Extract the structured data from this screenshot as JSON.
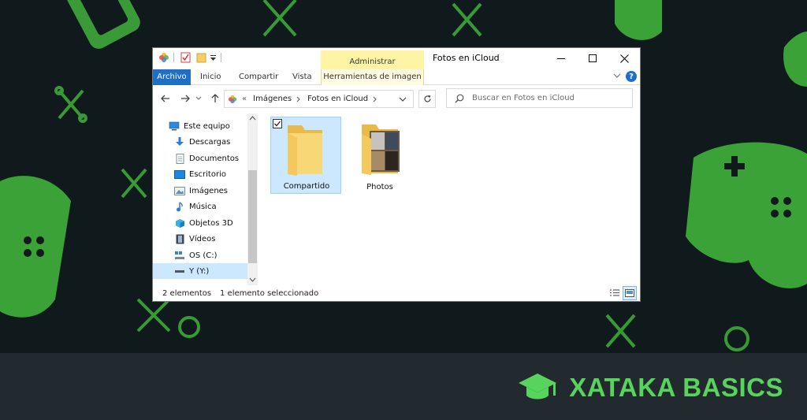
{
  "window": {
    "title": "Fotos en iCloud",
    "context_tab_group": "Administrar",
    "controls": {
      "minimize": "minimize-icon",
      "maximize": "maximize-icon",
      "close": "close-icon"
    }
  },
  "ribbon": {
    "tabs": [
      "Archivo",
      "Inicio",
      "Compartir",
      "Vista",
      "Herramientas de imagen"
    ],
    "active": "Archivo",
    "help_label": "?"
  },
  "address": {
    "overflow": "«",
    "crumbs": [
      "Imágenes",
      "Fotos en iCloud"
    ]
  },
  "search": {
    "placeholder": "Buscar en Fotos en iCloud"
  },
  "nav_pane": {
    "items": [
      {
        "label": "Este equipo",
        "icon": "computer-icon"
      },
      {
        "label": "Descargas",
        "icon": "download-icon"
      },
      {
        "label": "Documentos",
        "icon": "document-icon"
      },
      {
        "label": "Escritorio",
        "icon": "desktop-icon"
      },
      {
        "label": "Imágenes",
        "icon": "pictures-icon"
      },
      {
        "label": "Música",
        "icon": "music-icon"
      },
      {
        "label": "Objetos 3D",
        "icon": "cube-icon"
      },
      {
        "label": "Vídeos",
        "icon": "video-icon"
      },
      {
        "label": "OS (C:)",
        "icon": "drive-icon"
      },
      {
        "label": "Y (Y:)",
        "icon": "network-drive-icon"
      }
    ],
    "selected": "Y (Y:)"
  },
  "content": {
    "items": [
      {
        "label": "Compartido",
        "icon": "folder-icon",
        "selected": true,
        "checked": true
      },
      {
        "label": "Photos",
        "icon": "photo-folder-icon",
        "selected": false,
        "checked": false
      }
    ]
  },
  "status": {
    "count": "2 elementos",
    "selection": "1 elemento seleccionado"
  },
  "brand": {
    "text": "XATAKA BASICS",
    "color": "#57d45b"
  },
  "colors": {
    "accent": "#1f6fc5",
    "selection": "#cce8ff",
    "context_tab": "#fff3a6",
    "background": "#10191c"
  }
}
